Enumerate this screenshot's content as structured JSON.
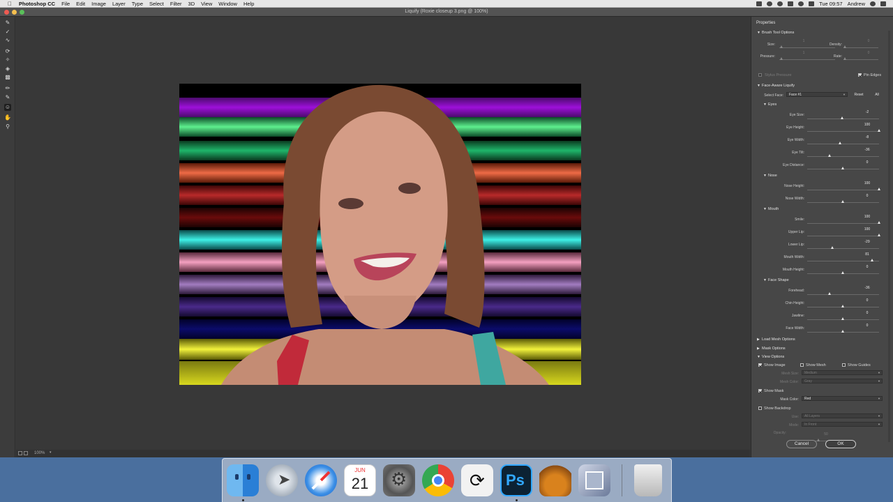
{
  "menubar": {
    "app_name": "Photoshop CC",
    "menus": [
      "File",
      "Edit",
      "Image",
      "Layer",
      "Type",
      "Select",
      "Filter",
      "3D",
      "View",
      "Window",
      "Help"
    ],
    "clock": "Tue 09:57",
    "user": "Andrew"
  },
  "window": {
    "title": "Liquify (Roxie closeup 3.png @ 100%)"
  },
  "statusbar": {
    "zoom": "100%"
  },
  "panel": {
    "title": "Properties",
    "brush": {
      "header": "Brush Tool Options",
      "size_label": "Size:",
      "size_value": "1",
      "density_label": "Density:",
      "density_value": "0",
      "pressure_label": "Pressure:",
      "pressure_value": "1",
      "rate_label": "Rate:",
      "rate_value": "0",
      "stylus_label": "Stylus Pressure",
      "pin_edges_label": "Pin Edges"
    },
    "face_aware": {
      "header": "Face-Aware Liquify",
      "select_face_label": "Select Face:",
      "select_face_value": "Face #1",
      "reset_label": "Reset",
      "all_label": "All",
      "groups": [
        {
          "name": "Eyes",
          "sliders": [
            {
              "label": "Eye Size:",
              "value": "-2",
              "fraction": 0.49
            },
            {
              "label": "Eye Height:",
              "value": "100",
              "fraction": 1.0
            },
            {
              "label": "Eye Width:",
              "value": "-8",
              "fraction": 0.46
            },
            {
              "label": "Eye Tilt:",
              "value": "-36",
              "fraction": 0.32
            },
            {
              "label": "Eye Distance:",
              "value": "0",
              "fraction": 0.5
            }
          ]
        },
        {
          "name": "Nose",
          "sliders": [
            {
              "label": "Nose Height:",
              "value": "100",
              "fraction": 1.0
            },
            {
              "label": "Nose Width:",
              "value": "0",
              "fraction": 0.5
            }
          ]
        },
        {
          "name": "Mouth",
          "sliders": [
            {
              "label": "Smile:",
              "value": "100",
              "fraction": 1.0
            },
            {
              "label": "Upper Lip:",
              "value": "100",
              "fraction": 1.0
            },
            {
              "label": "Lower Lip:",
              "value": "-29",
              "fraction": 0.355
            },
            {
              "label": "Mouth Width:",
              "value": "81",
              "fraction": 0.905
            },
            {
              "label": "Mouth Height:",
              "value": "0",
              "fraction": 0.5
            }
          ]
        },
        {
          "name": "Face Shape",
          "sliders": [
            {
              "label": "Forehead:",
              "value": "-36",
              "fraction": 0.32
            },
            {
              "label": "Chin Height:",
              "value": "0",
              "fraction": 0.5
            },
            {
              "label": "Jawline:",
              "value": "0",
              "fraction": 0.5
            },
            {
              "label": "Face Width:",
              "value": "0",
              "fraction": 0.5
            }
          ]
        }
      ]
    },
    "load_mesh": "Load Mesh Options",
    "mask_options": "Mask Options",
    "view_options": {
      "header": "View Options",
      "show_image": "Show Image",
      "show_mesh": "Show Mesh",
      "show_guides": "Show Guides",
      "mesh_size_label": "Mesh Size:",
      "mesh_size_value": "Medium",
      "mesh_color_label": "Mesh Color:",
      "mesh_color_value": "Gray"
    },
    "show_mask": {
      "label": "Show Mask",
      "mask_color_label": "Mask Color:",
      "mask_color_value": "Red"
    },
    "show_backdrop": {
      "label": "Show Backdrop",
      "use_label": "Use:",
      "use_value": "All Layers",
      "mode_label": "Mode:",
      "mode_value": "In Front",
      "opacity_label": "Opacity:",
      "opacity_value": "50"
    },
    "cancel_label": "Cancel",
    "ok_label": "OK"
  },
  "dock": {
    "apps": [
      "finder-icon",
      "launchpad-icon",
      "safari-icon",
      "calendar-icon",
      "system-preferences-icon",
      "chrome-icon",
      "clip-studio-icon",
      "photoshop-icon",
      "acorn-icon",
      "preview-icon",
      "trash-icon"
    ],
    "calendar_month": "JUN",
    "calendar_day": "21",
    "photoshop_label": "Ps"
  }
}
